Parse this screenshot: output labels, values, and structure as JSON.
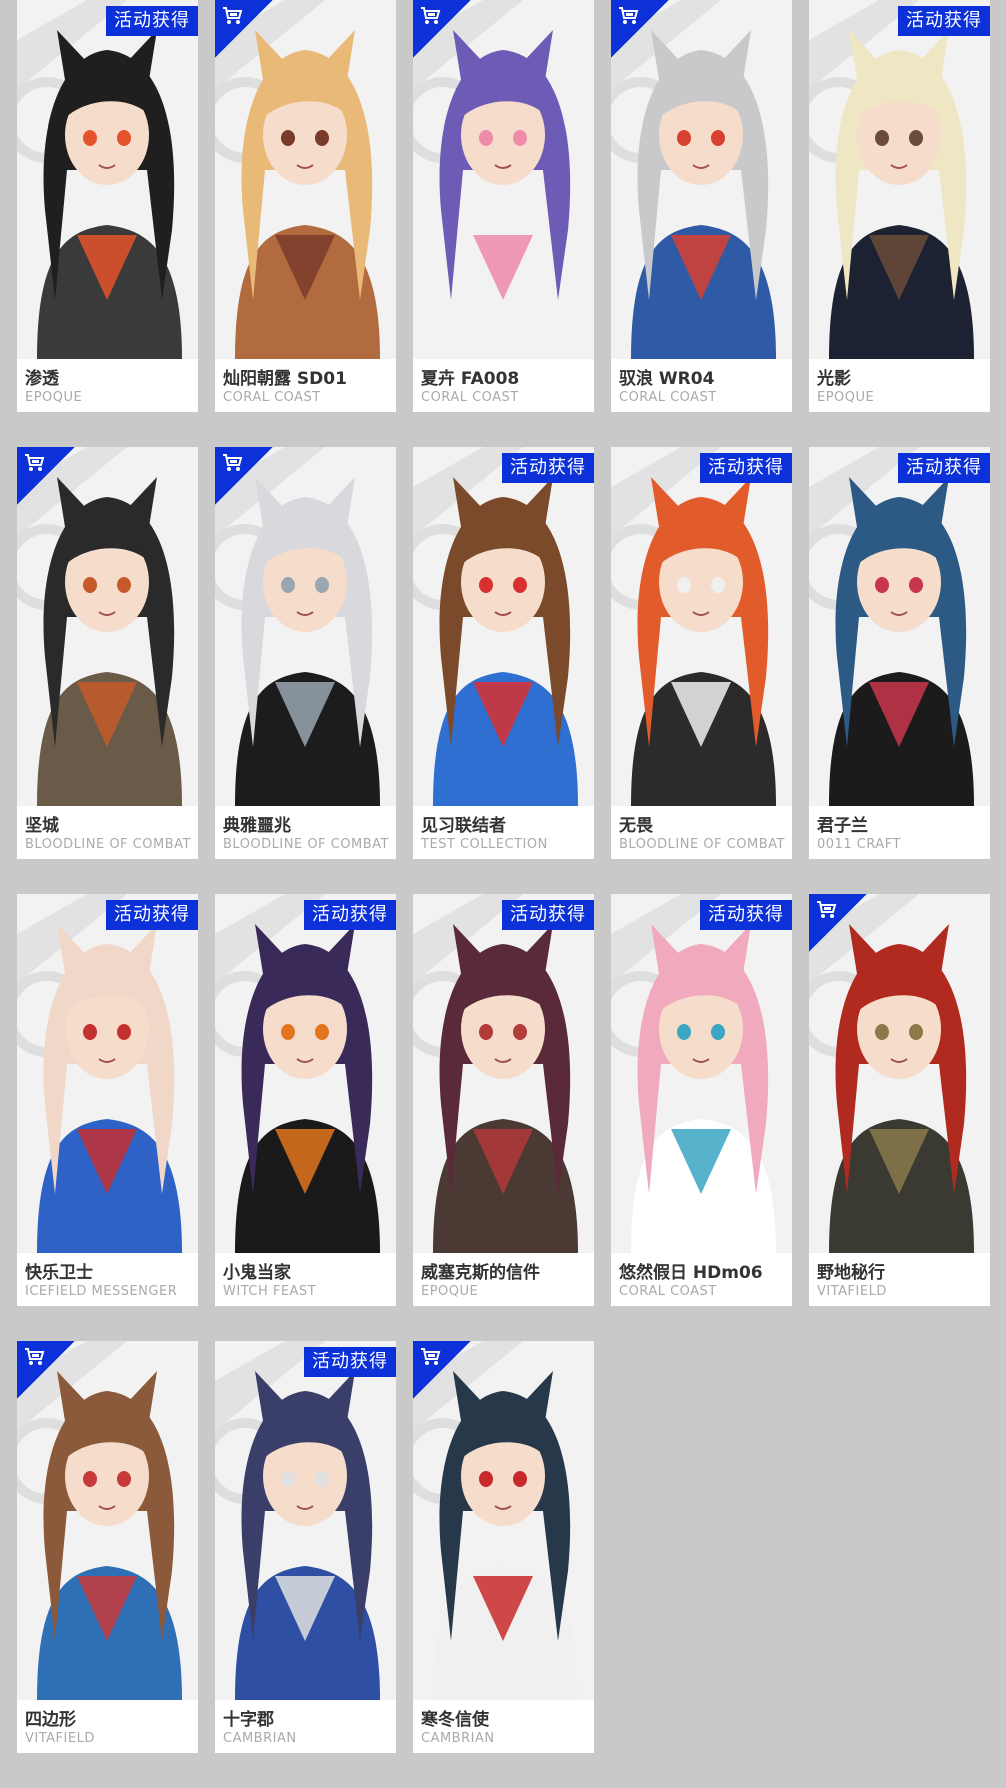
{
  "badges": {
    "event": "活动获得",
    "store": "store-icon"
  },
  "colors": {
    "badge_blue": "#0d31d8",
    "page_bg": "#c9c9c9",
    "card_bg": "#ffffff"
  },
  "skins": [
    {
      "name": "渗透",
      "series": "EPOQUE",
      "badge": "event",
      "hair": "#1f1f1f",
      "outfit": "#3a3a3a",
      "accent": "#e5532a"
    },
    {
      "name": "灿阳朝露 SD01",
      "series": "CORAL COAST",
      "badge": "store",
      "hair": "#e9b978",
      "outfit": "#b26a3f",
      "accent": "#7a3b2b"
    },
    {
      "name": "夏卉 FA008",
      "series": "CORAL COAST",
      "badge": "store",
      "hair": "#6d5bb5",
      "outfit": "#f2f2f2",
      "accent": "#f08aa9"
    },
    {
      "name": "驭浪 WR04",
      "series": "CORAL COAST",
      "badge": "store",
      "hair": "#c9c9cc",
      "outfit": "#2f5aa6",
      "accent": "#d8402f"
    },
    {
      "name": "光影",
      "series": "EPOQUE",
      "badge": "event",
      "hair": "#efe6c4",
      "outfit": "#1d2233",
      "accent": "#6b4b3a"
    },
    {
      "name": "坚城",
      "series": "BLOODLINE OF COMBAT",
      "badge": "store",
      "hair": "#2a2a2a",
      "outfit": "#6a5b48",
      "accent": "#c45a2a"
    },
    {
      "name": "典雅噩兆",
      "series": "BLOODLINE OF COMBAT",
      "badge": "store",
      "hair": "#d9d9dd",
      "outfit": "#1c1c1c",
      "accent": "#9aa6b2"
    },
    {
      "name": "见习联结者",
      "series": "TEST COLLECTION",
      "badge": "event",
      "hair": "#7a4a2a",
      "outfit": "#2f6fd1",
      "accent": "#d83030"
    },
    {
      "name": "无畏",
      "series": "BLOODLINE OF COMBAT",
      "badge": "event",
      "hair": "#e25b2a",
      "outfit": "#2b2b2b",
      "accent": "#f0f0f0"
    },
    {
      "name": "君子兰",
      "series": "0011 CRAFT",
      "badge": "event",
      "hair": "#2c5a85",
      "outfit": "#1b1b1b",
      "accent": "#c8364a"
    },
    {
      "name": "快乐卫士",
      "series": "ICEFIELD MESSENGER",
      "badge": "event",
      "hair": "#f0d7c8",
      "outfit": "#2f62c6",
      "accent": "#c43030"
    },
    {
      "name": "小鬼当家",
      "series": "WITCH FEAST",
      "badge": "event",
      "hair": "#3a2a5a",
      "outfit": "#1a1a1a",
      "accent": "#e2751f"
    },
    {
      "name": "威塞克斯的信件",
      "series": "EPOQUE",
      "badge": "event",
      "hair": "#5a2a3a",
      "outfit": "#4a3a33",
      "accent": "#b23a3a"
    },
    {
      "name": "悠然假日 HDm06",
      "series": "CORAL COAST",
      "badge": "event",
      "hair": "#f0a9bd",
      "outfit": "#ffffff",
      "accent": "#3aa6c2"
    },
    {
      "name": "野地秘行",
      "series": "VITAFIELD",
      "badge": "store",
      "hair": "#b02a20",
      "outfit": "#3a3a33",
      "accent": "#8a7a4a"
    },
    {
      "name": "四边形",
      "series": "VITAFIELD",
      "badge": "store",
      "hair": "#8a5a3a",
      "outfit": "#2f6fb5",
      "accent": "#c83a3a"
    },
    {
      "name": "十字郡",
      "series": "CAMBRIAN",
      "badge": "event",
      "hair": "#3a3f6a",
      "outfit": "#2f4fa5",
      "accent": "#e0e0e0"
    },
    {
      "name": "寒冬信使",
      "series": "CAMBRIAN",
      "badge": "store",
      "hair": "#26384a",
      "outfit": "#f0f0f0",
      "accent": "#c82a2a"
    }
  ]
}
